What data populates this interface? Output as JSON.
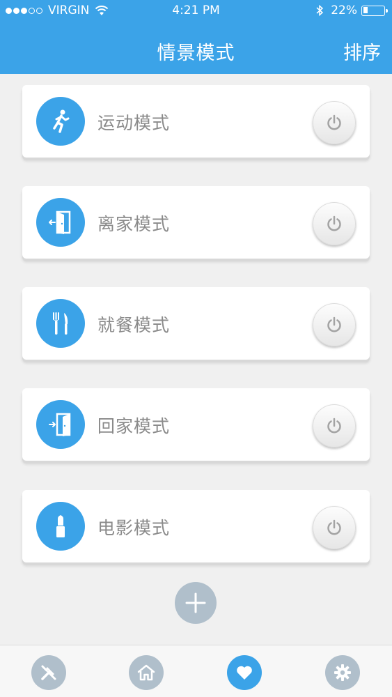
{
  "status_bar": {
    "carrier": "VIRGIN",
    "time": "4:21 PM",
    "battery_percent": "22%",
    "battery_level": 0.22,
    "signal_dots_full": 3,
    "signal_dots_total": 5
  },
  "header": {
    "title": "情景模式",
    "sort_label": "排序"
  },
  "modes": [
    {
      "label": "运动模式",
      "icon": "running-person-icon"
    },
    {
      "label": "离家模式",
      "icon": "door-exit-icon"
    },
    {
      "label": "就餐模式",
      "icon": "fork-knife-icon"
    },
    {
      "label": "回家模式",
      "icon": "door-enter-icon"
    },
    {
      "label": "电影模式",
      "icon": "movie-icon"
    }
  ],
  "tabs": [
    {
      "icon": "tools-icon",
      "active": false
    },
    {
      "icon": "home-icon",
      "active": false
    },
    {
      "icon": "heart-icon",
      "active": true
    },
    {
      "icon": "gear-icon",
      "active": false
    }
  ],
  "colors": {
    "accent": "#3ba3e8",
    "inactive_tab": "#b0bfcb",
    "background": "#f0f0f0"
  }
}
